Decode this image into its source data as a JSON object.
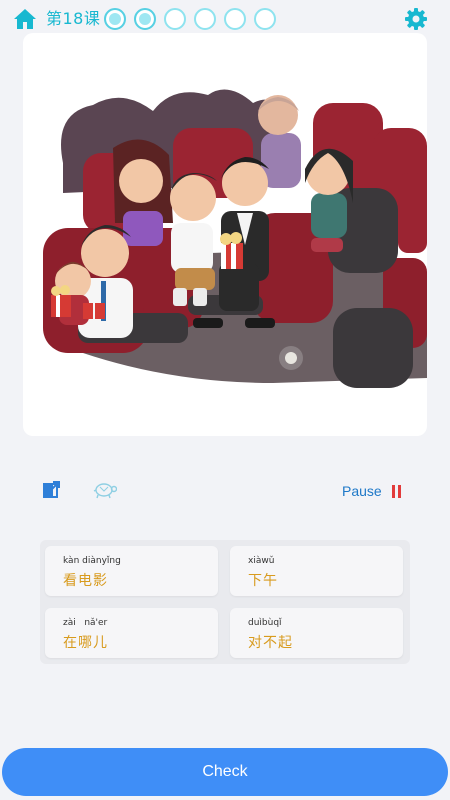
{
  "header": {
    "lesson_title": "第18课",
    "progress": {
      "completed": 2,
      "total": 6
    }
  },
  "icons": {
    "home": "home-icon",
    "settings": "gear-icon",
    "share": "share-icon",
    "slow": "turtle-icon",
    "pause": "pause-icon"
  },
  "image": {
    "description_icon": "cinema-illustration"
  },
  "controls": {
    "pause_label": "Pause"
  },
  "words": [
    {
      "pinyin": "kàn diànyǐng",
      "hanzi": "看电影"
    },
    {
      "pinyin": "xiàwǔ",
      "hanzi": "下午"
    },
    {
      "pinyin": "zài   nǎ'er",
      "hanzi": "在哪儿"
    },
    {
      "pinyin": "duìbùqǐ",
      "hanzi": "对不起"
    }
  ],
  "footer": {
    "check_label": "Check"
  },
  "colors": {
    "accent": "#18b8d0",
    "primary": "#3f8ef7",
    "hanzi": "#d89b1e",
    "pause": "#e23b3b"
  }
}
